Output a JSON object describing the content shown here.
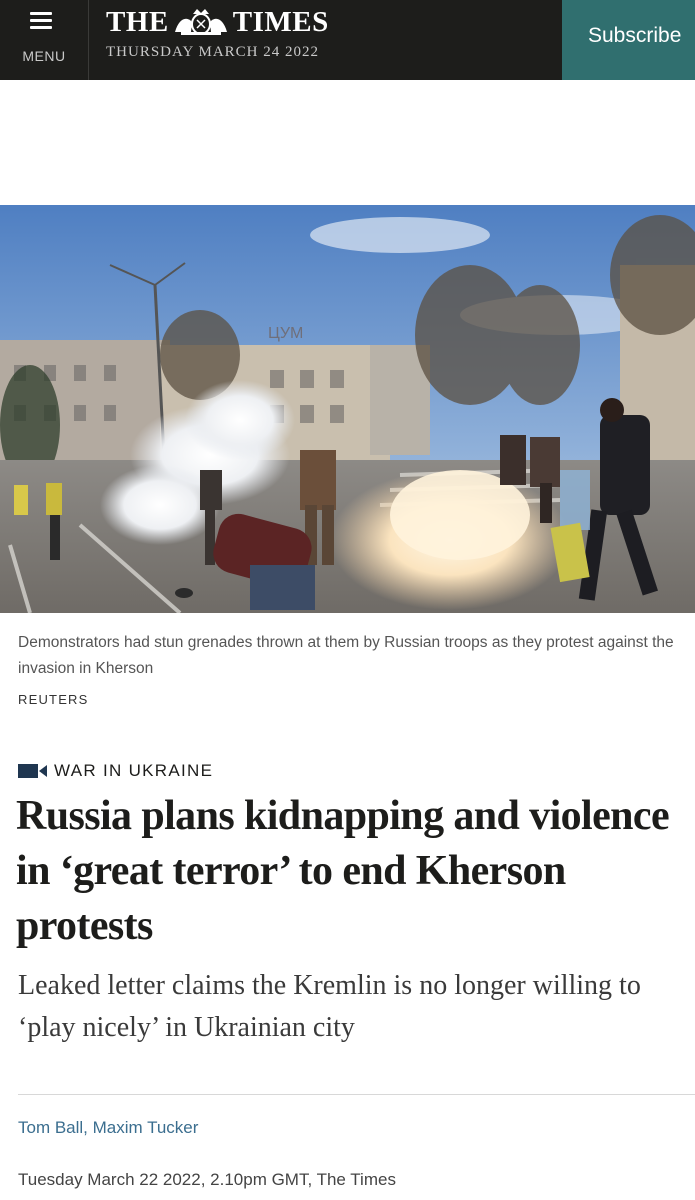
{
  "header": {
    "menu_label": "MENU",
    "masthead_left": "THE",
    "masthead_right": "TIMES",
    "date": "THURSDAY MARCH 24 2022",
    "subscribe_label": "Subscribe"
  },
  "photo": {
    "caption": "Demonstrators had stun grenades thrown at them by Russian troops as they protest against the invasion in Kherson",
    "credit": "REUTERS",
    "sign_text": "ЦУМ"
  },
  "article": {
    "section": "WAR IN UKRAINE",
    "headline": "Russia plans kidnapping and violence in ‘great terror’ to end Kherson protests",
    "standfirst": "Leaked letter claims the Kremlin is no longer willing to ‘play nicely’ in Ukrainian city",
    "authors": "Tom Ball, Maxim Tucker",
    "dateline": "Tuesday March 22 2022, 2.10pm GMT, The Times"
  },
  "colors": {
    "header_bg": "#1d1d1b",
    "subscribe_bg": "#306f6f",
    "author_link": "#3b6e8f"
  }
}
